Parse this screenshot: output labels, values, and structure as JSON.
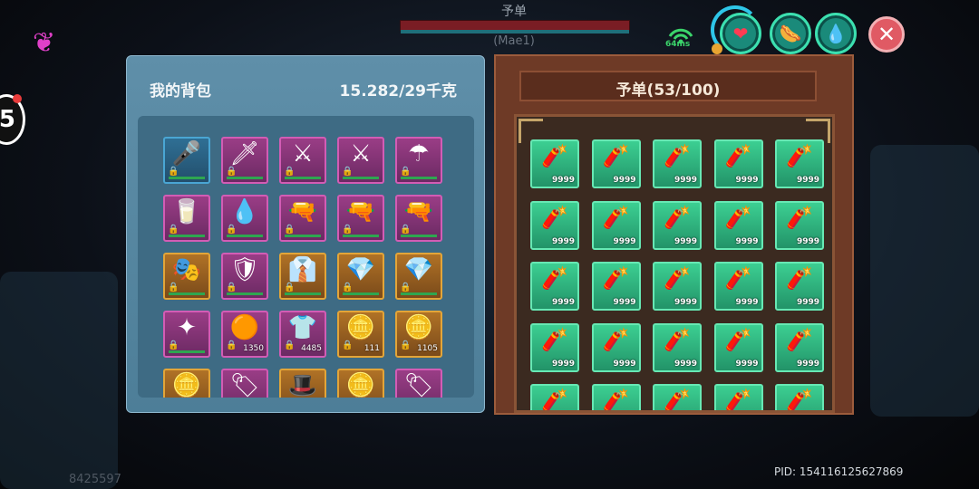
{
  "target": {
    "name": "予单",
    "sub": "(Mae1)"
  },
  "hud": {
    "ping": "64ms",
    "icons": [
      "wifi-icon",
      "heart-icon",
      "food-icon",
      "water-icon",
      "close-icon"
    ]
  },
  "left_edge": {
    "badge": "5"
  },
  "backpack": {
    "title": "我的背包",
    "weight": "15.282/29千克",
    "items": [
      {
        "icon": "microphone-icon",
        "glyph": "🎤",
        "style": "blue",
        "qty": ""
      },
      {
        "icon": "sword-icon",
        "glyph": "🗡",
        "style": "pink",
        "qty": ""
      },
      {
        "icon": "scythe-icon",
        "glyph": "⚔",
        "style": "pink",
        "qty": ""
      },
      {
        "icon": "scythe-icon",
        "glyph": "⚔",
        "style": "pink",
        "qty": ""
      },
      {
        "icon": "umbrella-icon",
        "glyph": "☂",
        "style": "pink",
        "qty": ""
      },
      {
        "icon": "milk-carton-icon",
        "glyph": "🥛",
        "style": "pink",
        "qty": ""
      },
      {
        "icon": "crystal-bottle-icon",
        "glyph": "💧",
        "style": "pink",
        "qty": ""
      },
      {
        "icon": "rifle-icon",
        "glyph": "🔫",
        "style": "pink",
        "qty": ""
      },
      {
        "icon": "rifle-icon",
        "glyph": "🔫",
        "style": "pink",
        "qty": ""
      },
      {
        "icon": "rifle-icon",
        "glyph": "🔫",
        "style": "pink",
        "qty": ""
      },
      {
        "icon": "jester-hat-icon",
        "glyph": "🎭",
        "style": "gold",
        "qty": ""
      },
      {
        "icon": "armor-icon",
        "glyph": "🛡",
        "style": "pink",
        "qty": ""
      },
      {
        "icon": "suit-icon",
        "glyph": "👔",
        "style": "gold",
        "qty": ""
      },
      {
        "icon": "gem-icon",
        "glyph": "💎",
        "style": "gold",
        "qty": ""
      },
      {
        "icon": "gem-icon",
        "glyph": "💎",
        "style": "gold",
        "qty": ""
      },
      {
        "icon": "earrings-icon",
        "glyph": "✦",
        "style": "pink",
        "qty": ""
      },
      {
        "icon": "orange-gem-icon",
        "glyph": "🟠",
        "style": "pink",
        "qty": "1350"
      },
      {
        "icon": "shirt-icon",
        "glyph": "👕",
        "style": "pink",
        "qty": "4485"
      },
      {
        "icon": "gold-coin-icon",
        "glyph": "🪙",
        "style": "gold",
        "qty": "111"
      },
      {
        "icon": "gold-coin-icon",
        "glyph": "🪙",
        "style": "gold",
        "qty": "1105"
      },
      {
        "icon": "gold-coin-icon",
        "glyph": "🪙",
        "style": "gold",
        "qty": ""
      },
      {
        "icon": "banner-icon",
        "glyph": "🏷",
        "style": "pink",
        "qty": ""
      },
      {
        "icon": "hat-icon",
        "glyph": "🎩",
        "style": "gold",
        "qty": ""
      },
      {
        "icon": "gold-coin-icon",
        "glyph": "🪙",
        "style": "gold",
        "qty": ""
      },
      {
        "icon": "banner-icon",
        "glyph": "🏷",
        "style": "pink",
        "qty": ""
      }
    ]
  },
  "storage": {
    "title": "予单(53/100)",
    "item": {
      "icon": "shotgun-shell-icon",
      "glyph": "🧨",
      "qty": "9999"
    },
    "visible_count": 25
  },
  "footer": {
    "left_id": "8425597",
    "pid": "PID: 154116125627869"
  }
}
